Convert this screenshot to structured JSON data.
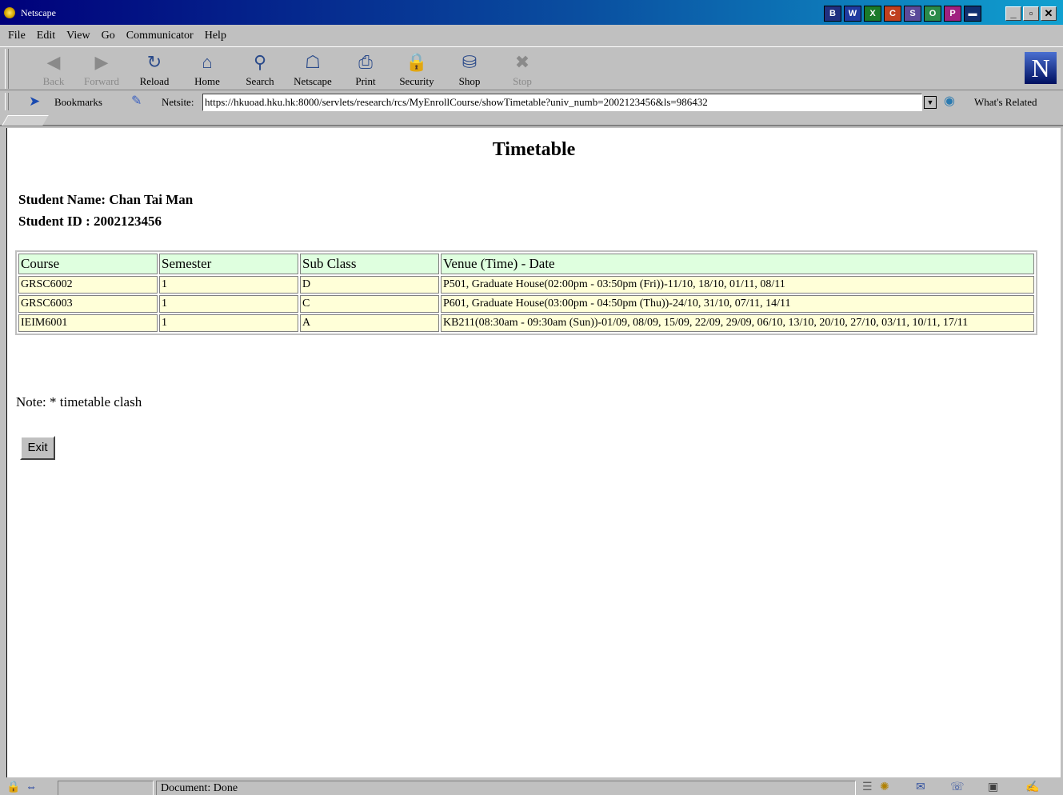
{
  "window": {
    "title": "Netscape",
    "tray_icons": [
      "B",
      "W",
      "X",
      "C",
      "S",
      "O",
      "P",
      "▬"
    ]
  },
  "menu": [
    "File",
    "Edit",
    "View",
    "Go",
    "Communicator",
    "Help"
  ],
  "toolbar": [
    {
      "label": "Back",
      "icon": "back-arrow-icon",
      "glyph": "◀",
      "enabled": false
    },
    {
      "label": "Forward",
      "icon": "forward-arrow-icon",
      "glyph": "▶",
      "enabled": false
    },
    {
      "label": "Reload",
      "icon": "reload-icon",
      "glyph": "↻",
      "enabled": true
    },
    {
      "label": "Home",
      "icon": "home-icon",
      "glyph": "⌂",
      "enabled": true
    },
    {
      "label": "Search",
      "icon": "search-icon",
      "glyph": "⚲",
      "enabled": true
    },
    {
      "label": "Netscape",
      "icon": "netscape-icon",
      "glyph": "☖",
      "enabled": true
    },
    {
      "label": "Print",
      "icon": "print-icon",
      "glyph": "⎙",
      "enabled": true
    },
    {
      "label": "Security",
      "icon": "lock-icon",
      "glyph": "🔒",
      "enabled": true
    },
    {
      "label": "Shop",
      "icon": "shop-icon",
      "glyph": "⛁",
      "enabled": true
    },
    {
      "label": "Stop",
      "icon": "stop-icon",
      "glyph": "✖",
      "enabled": false
    }
  ],
  "location": {
    "bookmarks_label": "Bookmarks",
    "netsite_label": "Netsite:",
    "url": "https://hkuoad.hku.hk:8000/servlets/research/rcs/MyEnrollCourse/showTimetable?univ_numb=2002123456&ls=986432",
    "whats_related": "What's Related"
  },
  "page": {
    "title": "Timetable",
    "student_name": "Student Name: Chan Tai Man",
    "student_id": "Student ID : 2002123456",
    "columns": [
      "Course",
      "Semester",
      "Sub Class",
      "Venue (Time) - Date"
    ],
    "rows": [
      [
        "GRSC6002",
        "1",
        "D",
        "P501, Graduate House(02:00pm - 03:50pm (Fri))-11/10, 18/10, 01/11, 08/11"
      ],
      [
        "GRSC6003",
        "1",
        "C",
        "P601, Graduate House(03:00pm - 04:50pm (Thu))-24/10, 31/10, 07/11, 14/11"
      ],
      [
        "IEIM6001",
        "1",
        "A",
        "KB211(08:30am - 09:30am (Sun))-01/09, 08/09, 15/09, 22/09, 29/09, 06/10, 13/10, 20/10, 27/10, 03/11, 10/11, 17/11"
      ]
    ],
    "note": "Note: * timetable clash",
    "exit_label": "Exit"
  },
  "status": {
    "text": "Document: Done"
  },
  "colors": {
    "header_row": "#dfffdf",
    "data_row": "#ffffd8",
    "titlebar": "#00007b"
  }
}
